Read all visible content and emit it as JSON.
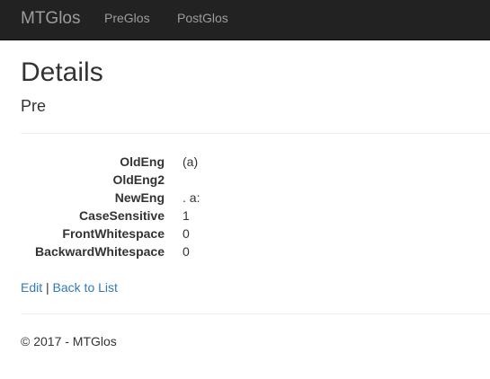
{
  "navbar": {
    "brand": "MTGlos",
    "links": [
      "PreGlos",
      "PostGlos"
    ]
  },
  "page": {
    "title": "Details",
    "subtitle": "Pre"
  },
  "details": [
    {
      "term": "OldEng",
      "value": "(a)"
    },
    {
      "term": "OldEng2",
      "value": ""
    },
    {
      "term": "NewEng",
      "value": ". a:"
    },
    {
      "term": "CaseSensitive",
      "value": "1"
    },
    {
      "term": "FrontWhitespace",
      "value": "0"
    },
    {
      "term": "BackwardWhitespace",
      "value": "0"
    }
  ],
  "actions": {
    "edit": "Edit",
    "separator": "|",
    "back": "Back to List"
  },
  "footer": {
    "text": "© 2017 - MTGlos"
  },
  "colors": {
    "navbar_bg": "#222222",
    "nav_text": "#9d9d9d",
    "link": "#337ab7",
    "text": "#333333"
  }
}
